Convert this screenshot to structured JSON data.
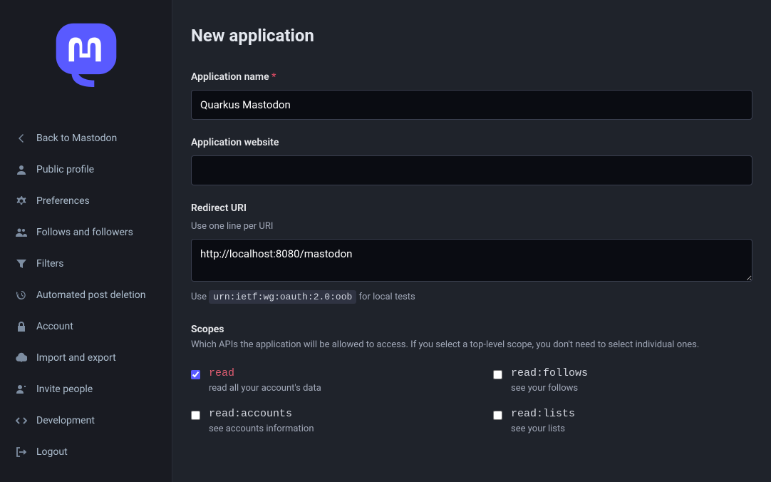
{
  "sidebar": {
    "items": [
      {
        "label": "Back to Mastodon"
      },
      {
        "label": "Public profile"
      },
      {
        "label": "Preferences"
      },
      {
        "label": "Follows and followers"
      },
      {
        "label": "Filters"
      },
      {
        "label": "Automated post deletion"
      },
      {
        "label": "Account"
      },
      {
        "label": "Import and export"
      },
      {
        "label": "Invite people"
      },
      {
        "label": "Development"
      },
      {
        "label": "Logout"
      }
    ]
  },
  "page": {
    "title": "New application"
  },
  "form": {
    "app_name": {
      "label": "Application name",
      "required_char": "*",
      "value": "Quarkus Mastodon"
    },
    "app_website": {
      "label": "Application website",
      "value": ""
    },
    "redirect_uri": {
      "label": "Redirect URI",
      "hint": "Use one line per URI",
      "value": "http://localhost:8080/mastodon",
      "post_hint_pre": "Use ",
      "post_hint_code": "urn:ietf:wg:oauth:2.0:oob",
      "post_hint_post": " for local tests"
    },
    "scopes": {
      "title": "Scopes",
      "desc": "Which APIs the application will be allowed to access. If you select a top-level scope, you don't need to select individual ones.",
      "items": [
        {
          "name": "read",
          "desc": "read all your account's data",
          "checked": true
        },
        {
          "name": "read:follows",
          "desc": "see your follows",
          "checked": false
        },
        {
          "name": "read:accounts",
          "desc": "see accounts information",
          "checked": false
        },
        {
          "name": "read:lists",
          "desc": "see your lists",
          "checked": false
        }
      ]
    }
  }
}
